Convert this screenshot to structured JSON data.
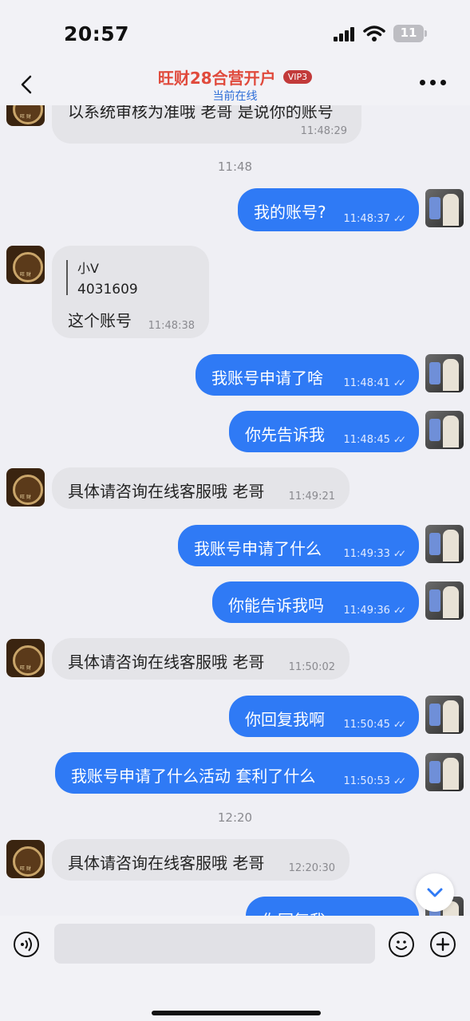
{
  "status": {
    "time": "20:57",
    "battery": "11"
  },
  "header": {
    "title": "旺财28合营开户",
    "vip": "VIP3",
    "subtitle": "当前在线"
  },
  "messages": [
    {
      "side": "left",
      "text": "以系统审核为准哦 老哥 是说你的账号",
      "time": "11:48:29"
    },
    {
      "type": "date",
      "text": "11:48"
    },
    {
      "side": "right",
      "text": "我的账号?",
      "time": "11:48:37"
    },
    {
      "side": "left",
      "quote_name": "小V",
      "quote_value": "4031609",
      "text": "这个账号",
      "time": "11:48:38"
    },
    {
      "side": "right",
      "text": "我账号申请了啥",
      "time": "11:48:41"
    },
    {
      "side": "right",
      "text": "你先告诉我",
      "time": "11:48:45"
    },
    {
      "side": "left",
      "text": "具体请咨询在线客服哦 老哥",
      "time": "11:49:21"
    },
    {
      "side": "right",
      "text": "我账号申请了什么",
      "time": "11:49:33"
    },
    {
      "side": "right",
      "text": "你能告诉我吗",
      "time": "11:49:36"
    },
    {
      "side": "left",
      "text": "具体请咨询在线客服哦 老哥",
      "time": "11:50:02"
    },
    {
      "side": "right",
      "text": "你回复我啊",
      "time": "11:50:45"
    },
    {
      "side": "right",
      "text": "我账号申请了什么活动 套利了什么",
      "time": "11:50:53"
    },
    {
      "type": "date",
      "text": "12:20"
    },
    {
      "side": "left",
      "text": "具体请咨询在线客服哦 老哥",
      "time": "12:20:30"
    },
    {
      "side": "right",
      "text": "你回复我",
      "time": ""
    }
  ],
  "input": {
    "placeholder": ""
  }
}
